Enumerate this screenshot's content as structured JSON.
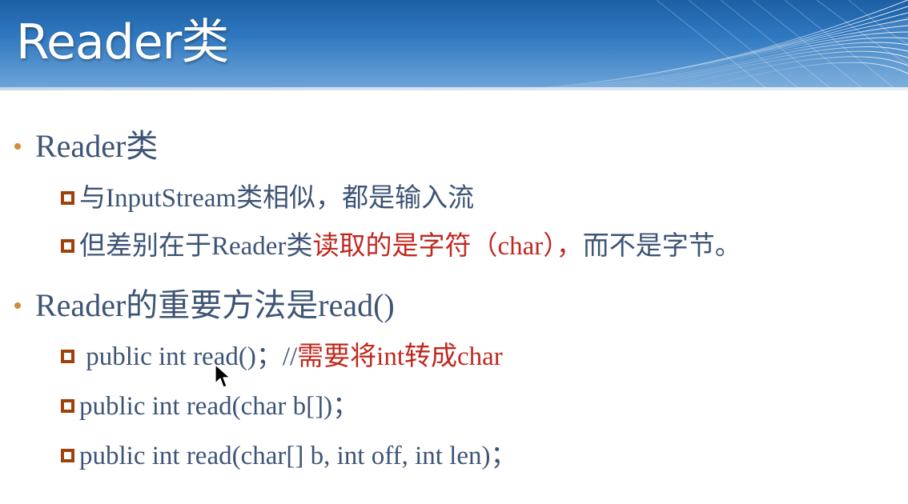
{
  "slide": {
    "title": "Reader类"
  },
  "bullets": [
    {
      "text": "Reader类",
      "items": [
        {
          "text": "与InputStream类相似，都是输入流"
        },
        {
          "text": "但差别在于Reader类",
          "highlight": "读取的是字符（char），",
          "tail": "而不是字节。"
        }
      ]
    },
    {
      "text": "Reader的重要方法是read()",
      "items": [
        {
          "text": " public int read()；//",
          "highlight": "需要将int转成char"
        },
        {
          "text": "public int read(char b[])；"
        },
        {
          "text": "public int read(char[] b, int off, int len)；"
        }
      ]
    }
  ],
  "colors": {
    "text": "#3d5475",
    "highlight": "#c0281f",
    "bullet_dot": "#d68a3c",
    "box": "#a0410d",
    "title_band": "#2f78c0"
  },
  "icons": {
    "bullet": "round-dot",
    "sub_bullet": "hollow-square",
    "cursor": "mouse-pointer-arrow"
  }
}
